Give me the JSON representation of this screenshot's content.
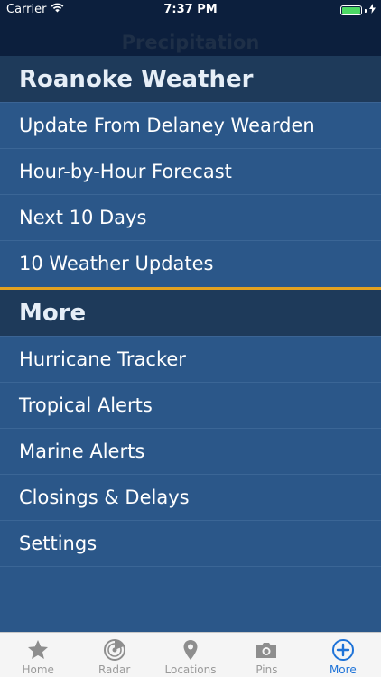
{
  "status_bar": {
    "carrier": "Carrier",
    "time": "7:37 PM",
    "battery_level": 1.0,
    "battery_color": "#4cd964"
  },
  "nav": {
    "title": "Precipitation"
  },
  "sections": [
    {
      "header": "Roanoke Weather",
      "items": [
        "Update From Delaney Wearden",
        "Hour-by-Hour Forecast",
        "Next 10 Days",
        "10 Weather Updates"
      ]
    },
    {
      "header": "More",
      "items": [
        "Hurricane Tracker",
        "Tropical Alerts",
        "Marine Alerts",
        "Closings & Delays",
        "Settings"
      ]
    }
  ],
  "accent_color": "#e3a11f",
  "tabs": [
    {
      "label": "Home",
      "icon": "star-icon",
      "active": false
    },
    {
      "label": "Radar",
      "icon": "radar-icon",
      "active": false
    },
    {
      "label": "Locations",
      "icon": "location-pin-icon",
      "active": false
    },
    {
      "label": "Pins",
      "icon": "camera-icon",
      "active": false
    },
    {
      "label": "More",
      "icon": "plus-circle-icon",
      "active": true
    }
  ]
}
